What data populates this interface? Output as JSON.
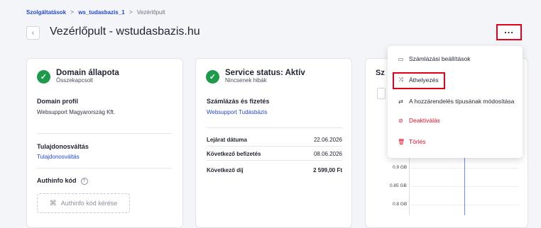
{
  "breadcrumb": [
    "Szolgáltatások",
    "ws_tudasbazis_1",
    "Vezérlőpult"
  ],
  "breadcrumb_sep": ">",
  "page_title": "Vezérlőpult - wstudasbazis.hu",
  "icons": {
    "back": "chevron-left-icon",
    "more": "more-horizontal-icon",
    "check": "check-circle-icon",
    "info": "info-icon",
    "key": "key-icon"
  },
  "card1": {
    "status_title": "Domain állapota",
    "status_sub": "Összekapcsolt",
    "profile_label": "Domain profil",
    "profile_value": "Websupport Magyarország Kft.",
    "transfer_label": "Tulajdonosváltás",
    "transfer_link": "Tulajdonosváltás",
    "authinfo_label": "Authinfo kód",
    "authinfo_button": "Authinfo kód kérése"
  },
  "card2": {
    "status_title": "Service status: Aktív",
    "status_sub": "Nincsenek hibák",
    "billing_label": "Számlázás és fizetés",
    "billing_link": "Websupport Tudásbázis",
    "rows": [
      {
        "k": "Lejárat dátuma",
        "v": "22.06.2026"
      },
      {
        "k": "Következő befizetés",
        "v": "08.06.2026"
      },
      {
        "k": "Következő díj",
        "v": "2 599,00 Ft"
      }
    ]
  },
  "card3": {
    "title": "Sz",
    "y_ticks": [
      "0.9 GB",
      "0.85 GB",
      "0.8 GB"
    ]
  },
  "menu": {
    "items": [
      {
        "label": "Számlázási beállítások",
        "icon": "billing-icon",
        "danger": false
      },
      {
        "label": "Áthelyezés",
        "icon": "move-icon",
        "danger": false
      },
      {
        "label": "A hozzárendelés típusának módosítása",
        "icon": "swap-icon",
        "danger": false
      },
      {
        "label": "Deaktiválás",
        "icon": "deactivate-icon",
        "danger": true
      },
      {
        "label": "Törlés",
        "icon": "trash-icon",
        "danger": true
      }
    ]
  },
  "colors": {
    "accent": "#2449c7",
    "success": "#1f9a4d",
    "danger": "#d9112e",
    "highlight": "#e2001a"
  }
}
